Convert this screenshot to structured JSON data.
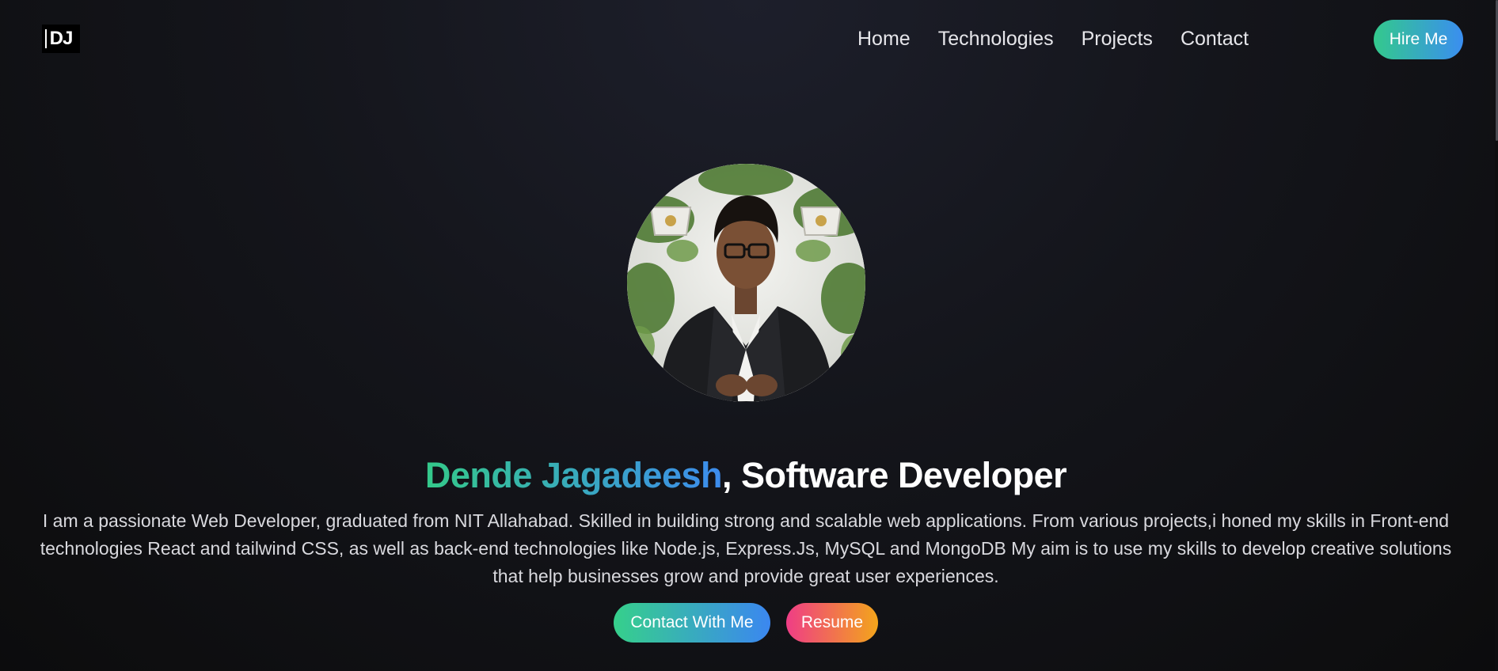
{
  "logo": {
    "text": "DJ"
  },
  "nav": {
    "items": [
      {
        "label": "Home"
      },
      {
        "label": "Technologies"
      },
      {
        "label": "Projects"
      },
      {
        "label": "Contact"
      }
    ],
    "hire_label": "Hire Me"
  },
  "hero": {
    "name": "Dende Jagadeesh",
    "role": ", Software Developer",
    "description": "I am a passionate Web Developer, graduated from NIT Allahabad. Skilled in building strong and scalable web applications. From various projects,i honed my skills in Front-end technologies React and tailwind CSS, as well as back-end technologies like Node.js, Express.Js, MySQL and MongoDB My aim is to use my skills to develop creative solutions that help businesses grow and provide great user experiences.",
    "contact_label": "Contact With Me",
    "resume_label": "Resume"
  },
  "colors": {
    "accent_green": "#34c98a",
    "accent_blue": "#3d8cee",
    "resume_pink": "#ef3d86",
    "resume_orange": "#f3a51b",
    "background": "#0c0c0d"
  }
}
